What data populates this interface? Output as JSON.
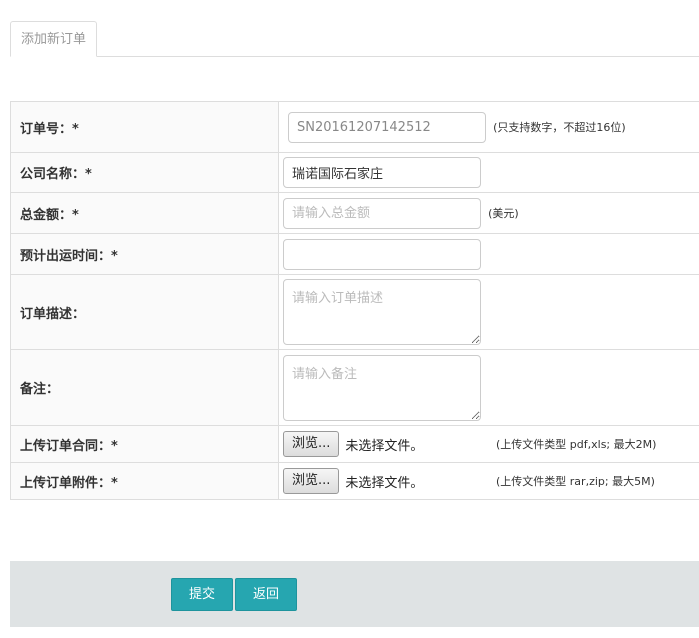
{
  "tabs": [
    {
      "label": "添加新订单"
    }
  ],
  "form": {
    "order_no": {
      "label": "订单号：*",
      "value": "SN20161207142512",
      "hint": "(只支持数字，不超过16位)"
    },
    "company": {
      "label": "公司名称：*",
      "value": "瑞诺国际石家庄"
    },
    "amount": {
      "label": "总金额：*",
      "placeholder": "请输入总金额",
      "hint": "(美元)"
    },
    "ship_time": {
      "label": "预计出运时间：*",
      "value": ""
    },
    "description": {
      "label": "订单描述：",
      "placeholder": "请输入订单描述"
    },
    "remark": {
      "label": "备注：",
      "placeholder": "请输入备注"
    },
    "contract": {
      "label": "上传订单合同：*",
      "browse": "浏览...",
      "status": "未选择文件。",
      "hint": "(上传文件类型 pdf,xls; 最大2M)"
    },
    "attachment": {
      "label": "上传订单附件：*",
      "browse": "浏览...",
      "status": "未选择文件。",
      "hint": "(上传文件类型 rar,zip; 最大5M)"
    }
  },
  "actions": {
    "submit": "提交",
    "back": "返回"
  },
  "colors": {
    "accent": "#26a6b0",
    "footer_bg": "#dfe3e4",
    "border": "#dddddd"
  }
}
